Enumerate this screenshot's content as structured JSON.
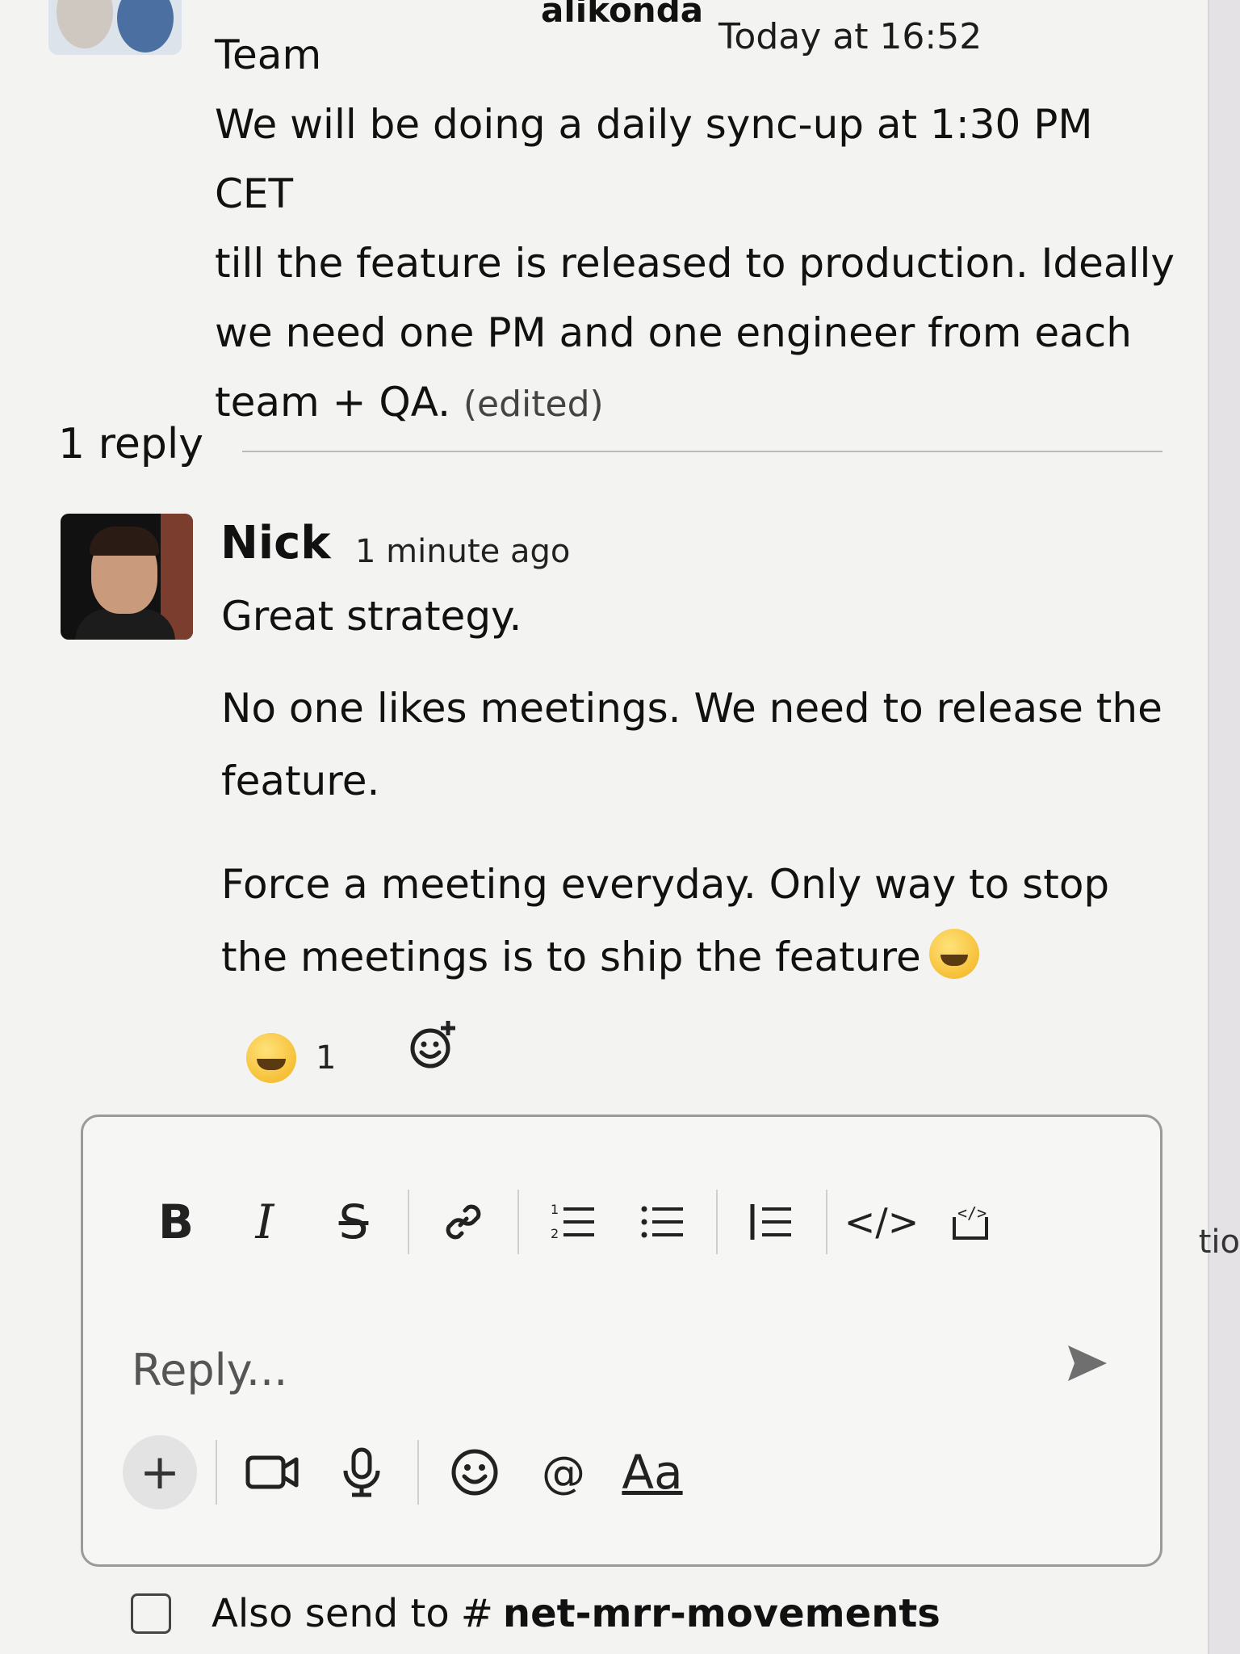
{
  "parent_message": {
    "author_partial": "alikonda",
    "timestamp": "Today at 16:52",
    "line_1": "Team",
    "line_2": "We will be doing a daily sync-up at 1:30 PM CET",
    "line_3": "till the feature is released to production. Ideally",
    "line_4": "we need one PM and one engineer from each",
    "line_5": "team + QA.",
    "edited_label": "(edited)"
  },
  "thread": {
    "reply_count": "1 reply"
  },
  "reply": {
    "author": "Nick",
    "timestamp": "1 minute ago",
    "paragraph_1": "Great strategy.",
    "paragraph_2": "No one likes meetings. We need to release the feature.",
    "paragraph_3": "Force a meeting everyday. Only way to stop the meetings is to ship the feature",
    "inline_emoji": "grinning-sweat",
    "reactions": [
      {
        "emoji": "grinning-face",
        "count": "1"
      }
    ]
  },
  "composer": {
    "toolbar": {
      "bold": "B",
      "italic": "I",
      "strike": "S",
      "code_label": "</>"
    },
    "placeholder": "Reply...",
    "format_toggle": "Aa",
    "mention": "@"
  },
  "also_send": {
    "label": "Also send to",
    "hash": "#",
    "channel": "net-mrr-movements"
  },
  "right_edge_text": "tio"
}
